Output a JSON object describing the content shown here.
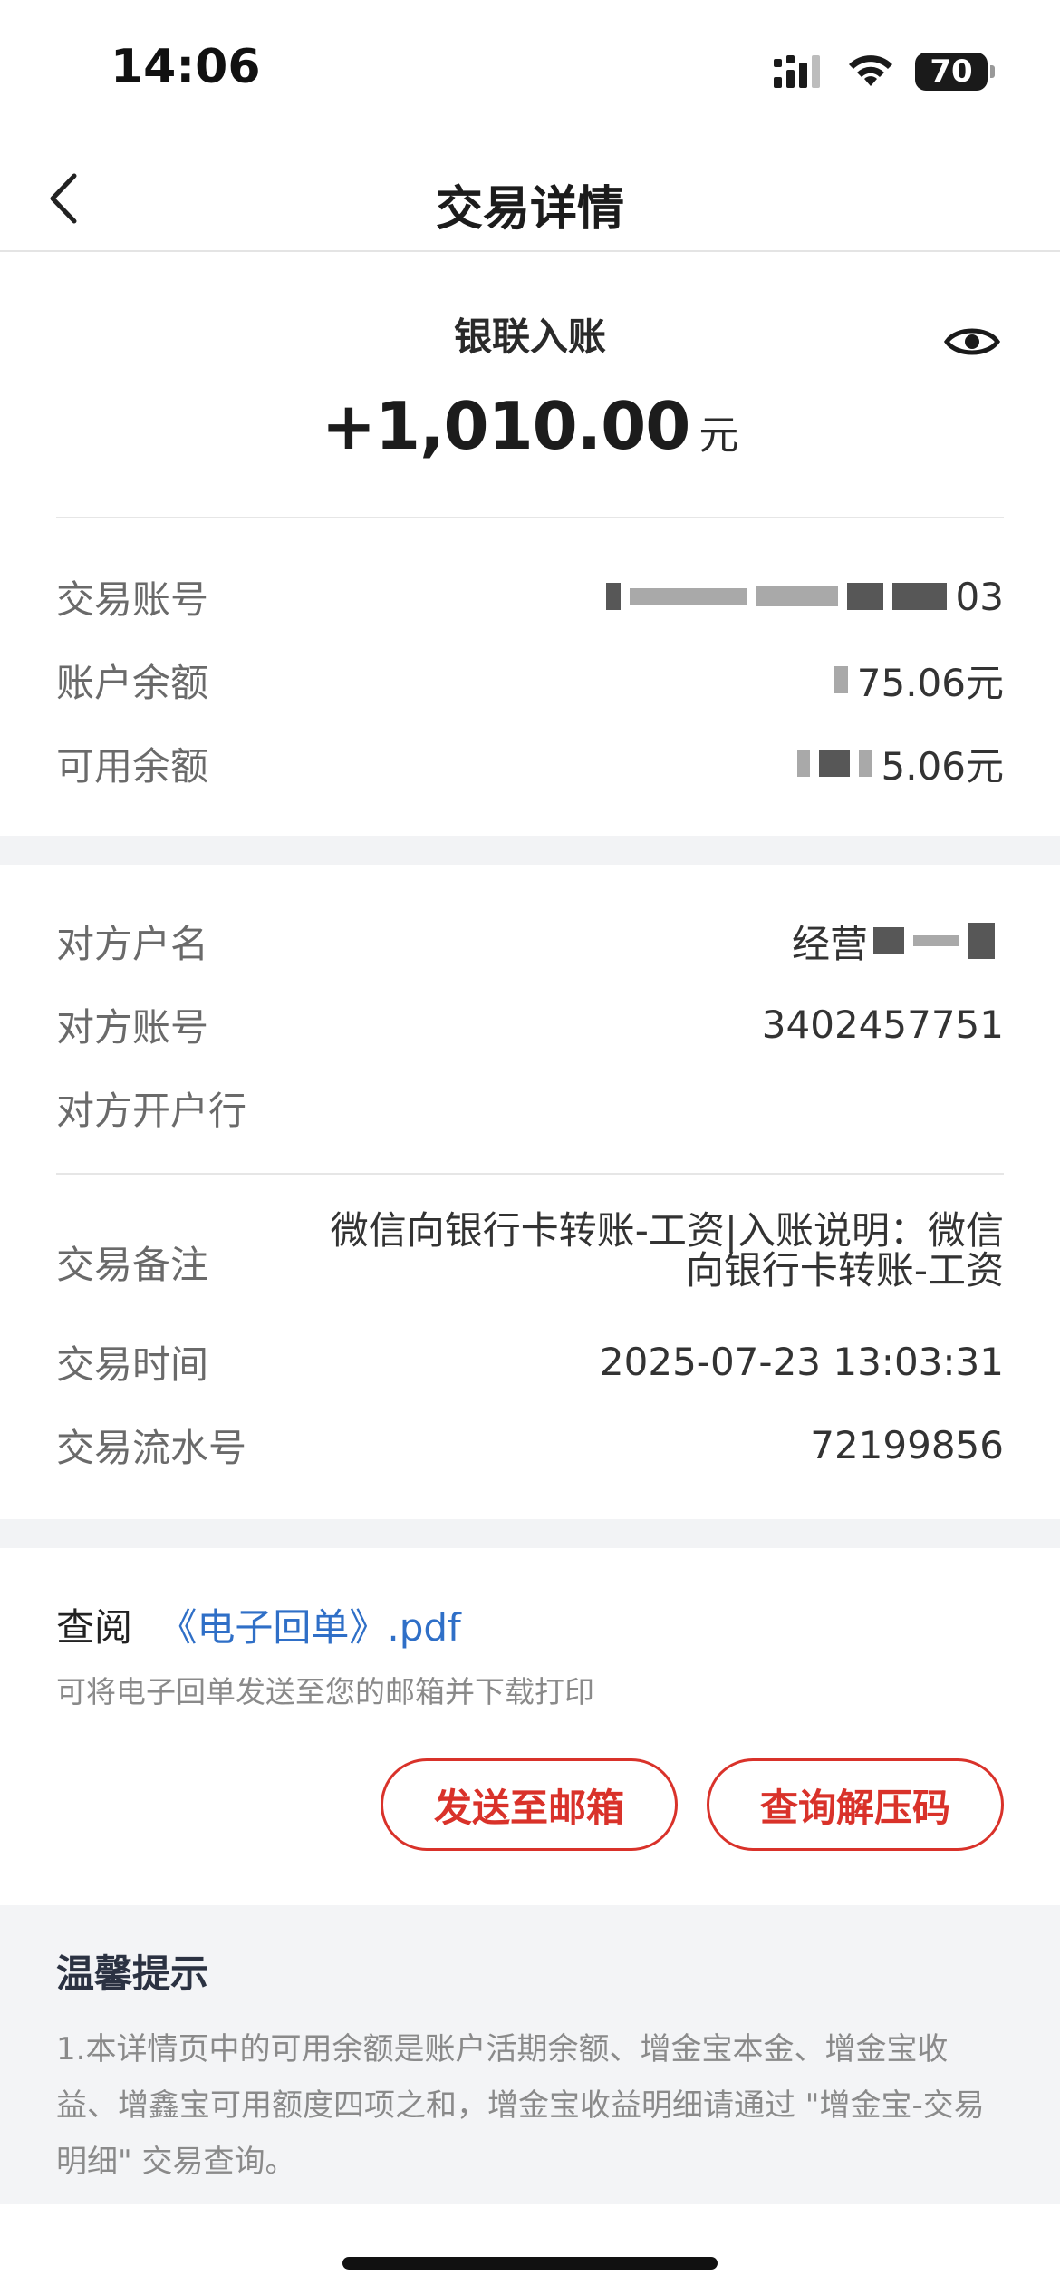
{
  "status_bar": {
    "time": "14:06",
    "battery": "70",
    "icons": [
      "cellular-signal-icon",
      "wifi-icon",
      "battery-icon"
    ]
  },
  "nav": {
    "title": "交易详情",
    "back_icon": "chevron-left-icon"
  },
  "header": {
    "title": "银联入账",
    "amount": "+1,010.00",
    "unit": "元",
    "eye_icon": "eye-icon"
  },
  "account_info": {
    "account_no": {
      "label": "交易账号",
      "value": "03"
    },
    "balance": {
      "label": "账户余额",
      "value": "75.06元"
    },
    "available": {
      "label": "可用余额",
      "value": "5.06元"
    }
  },
  "counterparty": {
    "name": {
      "label": "对方户名",
      "value": "经营"
    },
    "account": {
      "label": "对方账号",
      "value": "3402457751"
    },
    "bank": {
      "label": "对方开户行",
      "value": ""
    }
  },
  "transaction": {
    "memo": {
      "label": "交易备注",
      "value": "微信向银行卡转账-工资|入账说明：微信向银行卡转账-工资"
    },
    "time": {
      "label": "交易时间",
      "value": "2025-07-23 13:03:31"
    },
    "serial": {
      "label": "交易流水号",
      "value": "72199856"
    }
  },
  "receipt": {
    "view_label": "查阅",
    "link_text": "《电子回单》.pdf",
    "description": "可将电子回单发送至您的邮箱并下载打印",
    "send_button": "发送至邮箱",
    "code_button": "查询解压码"
  },
  "tips": {
    "title": "温馨提示",
    "body": "1.本详情页中的可用余额是账户活期余额、增金宝本金、增金宝收益、增鑫宝可用额度四项之和，增金宝收益明细请通过 \"增金宝-交易明细\" 交易查询。"
  },
  "colors": {
    "accent_red": "#d9322a",
    "link_blue": "#2f6fc7",
    "section_gap": "#f2f3f5"
  }
}
